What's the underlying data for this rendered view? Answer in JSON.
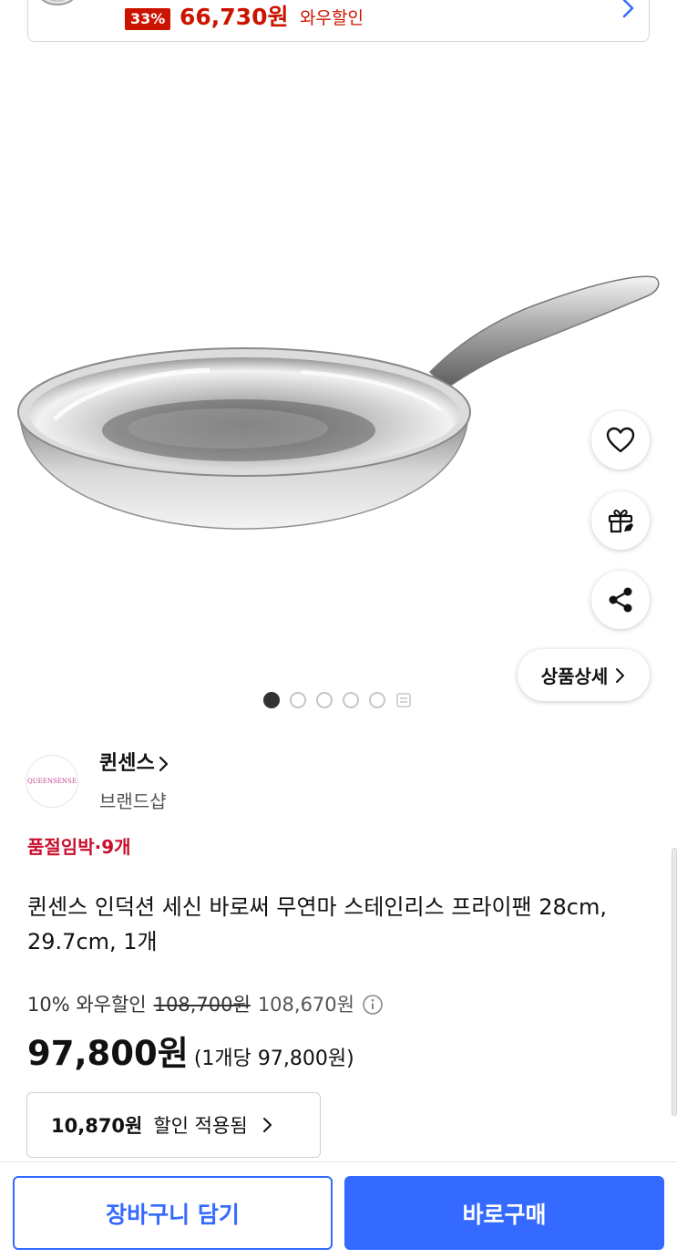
{
  "top_banner": {
    "discount_badge": "33%",
    "price": "66,730원",
    "price_suffix": "와우할인"
  },
  "actions": {
    "like_icon": "heart-icon",
    "gift_icon": "gift-icon",
    "share_icon": "share-icon",
    "detail_label": "상품상세"
  },
  "carousel": {
    "total_dots": 5,
    "active_index": 0
  },
  "brand": {
    "logo_text": "QUEENSENSE",
    "name": "퀸센스",
    "subtitle": "브랜드샵"
  },
  "stock_alert": "품절임박·9개",
  "product": {
    "title": "퀸센스 인덕션 세신 바로써 무연마 스테인리스 프라이팬 28cm, 29.7cm, 1개"
  },
  "pricing": {
    "wow_discount": "10% 와우할인",
    "original_price": "108,700원",
    "coupon_price": "108,670원",
    "final_price": "97,800원",
    "unit_price": "(1개당 97,800원)",
    "discount_amount": "10,870원",
    "discount_label": "할인 적용됨"
  },
  "bottom_bar": {
    "cart_label": "장바구니 담기",
    "buy_label": "바로구매"
  },
  "colors": {
    "accent_blue": "#346aff",
    "sale_red": "#cb1400",
    "alert_red": "#c8102e"
  }
}
